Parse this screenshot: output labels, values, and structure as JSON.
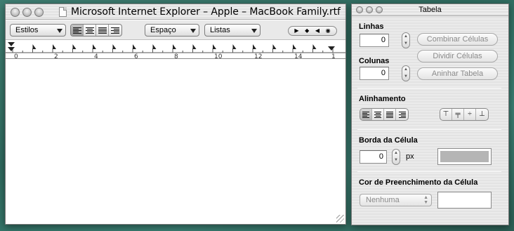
{
  "main_window": {
    "title": "Microsoft Internet Explorer – Apple – MacBook Family.rtf",
    "toolbar": {
      "styles_label": "Estilos",
      "spacing_label": "Espaço",
      "lists_label": "Listas",
      "alignment_selected": "left"
    },
    "ruler": {
      "labels": [
        "0",
        "2",
        "4",
        "6",
        "8",
        "10",
        "12",
        "14",
        "1"
      ]
    }
  },
  "table_palette": {
    "title": "Tabela",
    "rows": {
      "label": "Linhas",
      "value": "0"
    },
    "columns": {
      "label": "Colunas",
      "value": "0"
    },
    "buttons": {
      "merge": "Combinar Células",
      "split": "Dividir Células",
      "nest": "Aninhar Tabela"
    },
    "alignment": {
      "label": "Alinhamento",
      "horizontal_selected": "left"
    },
    "cell_border": {
      "label": "Borda da Célula",
      "value": "0",
      "unit": "px",
      "color": "#b5b5b5"
    },
    "cell_fill": {
      "label": "Cor de Preenchimento da Célula",
      "popup_value": "Nenhuma",
      "color": "#ffffff"
    }
  },
  "colors": {
    "desktop": "#3b7a6e",
    "window_bg": "#ececec",
    "disabled_text": "#8a8a8a"
  }
}
